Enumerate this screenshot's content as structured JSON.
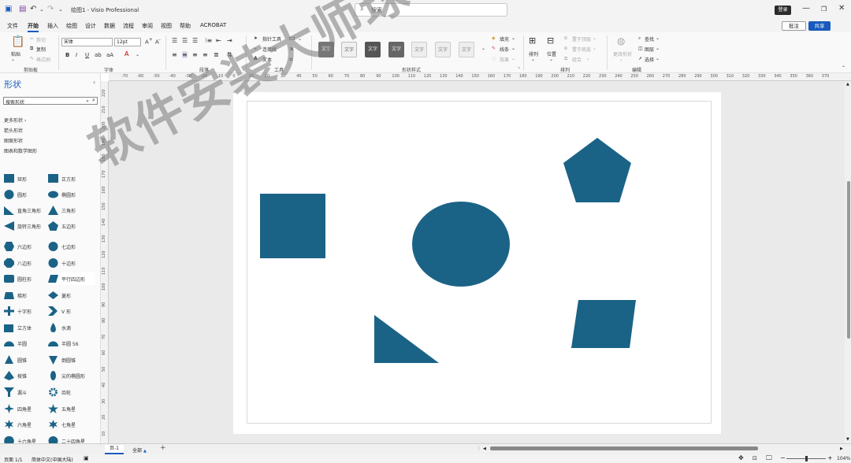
{
  "titlebar": {
    "doc_title": "绘图1  -  Visio Professional",
    "search_placeholder": "搜索",
    "login": "登录"
  },
  "menu": [
    "文件",
    "开始",
    "插入",
    "绘图",
    "设计",
    "数据",
    "流程",
    "审阅",
    "视图",
    "帮助",
    "ACROBAT"
  ],
  "menu_right": {
    "comment": "批注",
    "share": "共享"
  },
  "ribbon": {
    "clipboard": {
      "paste": "粘贴",
      "cut": "剪切",
      "copy": "复制",
      "format_painter": "格式刷",
      "label": "剪贴板"
    },
    "font": {
      "font_name": "宋体",
      "font_size": "12pt",
      "label": "字体"
    },
    "paragraph": {
      "label": "段落"
    },
    "tools": {
      "pointer": "指针工具",
      "connector": "连接线",
      "text": "文本",
      "label": "工具"
    },
    "shape_styles": {
      "swatch": "文字",
      "label": "形状样式",
      "fill": "填充",
      "line": "线条",
      "effects": "效果"
    },
    "arrange": {
      "arrange": "排列",
      "position": "位置",
      "bring_front": "置于顶层",
      "send_back": "置于底层",
      "group": "组合",
      "label": "排列"
    },
    "editing": {
      "change_shape": "更改形状",
      "find": "查找",
      "layers": "图层",
      "select": "选择",
      "label": "编辑"
    }
  },
  "shapes_panel": {
    "title": "形状",
    "search_placeholder": "搜索形状",
    "more_shapes": "更多形状",
    "stencils": [
      "箭头形状",
      "图案形状",
      "图表和数学图形"
    ],
    "items": [
      "矩形",
      "正方形",
      "圆形",
      "椭圆形",
      "直角三角形",
      "三角形",
      "旋转三角形",
      "五边形",
      "六边形",
      "七边形",
      "八边形",
      "十边形",
      "圆柱形",
      "平行四边形",
      "梯形",
      "菱形",
      "十字形",
      "V 形",
      "立方体",
      "水滴",
      "半圆",
      "半圆 56",
      "圆锥",
      "倒圆锥",
      "棱锥",
      "尖的椭圆形",
      "漏斗",
      "齿轮",
      "四角星",
      "五角星",
      "六角星",
      "七角星",
      "十六角星",
      "二十四角星"
    ]
  },
  "hruler_ticks": [
    "-70",
    "-60",
    "-50",
    "-40",
    "-30",
    "-20",
    "-10",
    "0",
    "10",
    "20",
    "30",
    "40",
    "50",
    "60",
    "70",
    "80",
    "90",
    "100",
    "110",
    "120",
    "130",
    "140",
    "150",
    "160",
    "170",
    "180",
    "190",
    "200",
    "210",
    "220",
    "230",
    "240",
    "250",
    "260",
    "270",
    "280",
    "290",
    "300",
    "310",
    "320",
    "330",
    "340",
    "350",
    "360",
    "370"
  ],
  "vruler_ticks": [
    "220",
    "210",
    "200",
    "190",
    "180",
    "170",
    "160",
    "150",
    "140",
    "130",
    "120",
    "110",
    "100",
    "90",
    "80",
    "70",
    "60",
    "50",
    "40",
    "30",
    "20",
    "10",
    "0"
  ],
  "tabs": {
    "page1": "页-1",
    "all": "全部"
  },
  "status": {
    "page": "页面 1/1",
    "language": "简体中文(中国大陆)",
    "zoom": "104%"
  },
  "canvas_shapes": [
    "square",
    "ellipse",
    "pentagon",
    "right-triangle",
    "parallelogram"
  ],
  "colors": {
    "shape_fill": "#1b6386",
    "accent": "#185abd"
  },
  "watermark": "软件安装大师球"
}
